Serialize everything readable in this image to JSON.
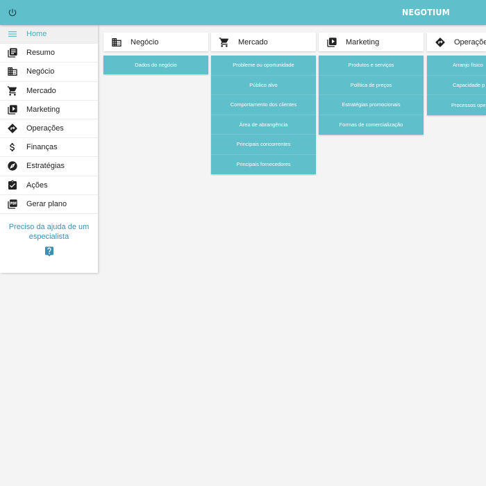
{
  "header": {
    "brand": "NEGOTIUM",
    "power_icon": "power-icon"
  },
  "sidebar": {
    "items": [
      {
        "label": "Home",
        "icon": "menu-icon",
        "active": true
      },
      {
        "label": "Resumo",
        "icon": "library-books-icon"
      },
      {
        "label": "Negócio",
        "icon": "building-icon"
      },
      {
        "label": "Mercado",
        "icon": "shopping-cart-icon"
      },
      {
        "label": "Marketing",
        "icon": "video-library-icon"
      },
      {
        "label": "Operações",
        "icon": "directions-icon"
      },
      {
        "label": "Finanças",
        "icon": "dollar-icon"
      },
      {
        "label": "Estratégias",
        "icon": "compass-icon"
      },
      {
        "label": "Ações",
        "icon": "assignment-check-icon"
      },
      {
        "label": "Gerar plano",
        "icon": "pdf-icon"
      }
    ],
    "help_text": "Preciso da ajuda de um especialista",
    "help_icon": "help-icon"
  },
  "columns": [
    {
      "title": "Negócio",
      "icon": "building-icon",
      "items": [
        "Dados do negócio"
      ]
    },
    {
      "title": "Mercado",
      "icon": "shopping-cart-icon",
      "items": [
        "Probleme ou oportunidade",
        "Público alvo",
        "Comportamento dos clientes",
        "Área de abrangência",
        "Principais concorrentes",
        "Principais fornecedores"
      ]
    },
    {
      "title": "Marketing",
      "icon": "video-library-icon",
      "items": [
        "Produtos e serviços",
        "Política de preços",
        "Estratégias promocionais",
        "Formas de comercialização"
      ]
    },
    {
      "title": "Operações",
      "icon": "directions-icon",
      "items": [
        "Arranjo físico",
        "Capacidade p",
        "Processos ope"
      ]
    }
  ],
  "colors": {
    "primary": "#5fbfca",
    "link": "#3f8fb5",
    "background": "#f4f4f4"
  }
}
